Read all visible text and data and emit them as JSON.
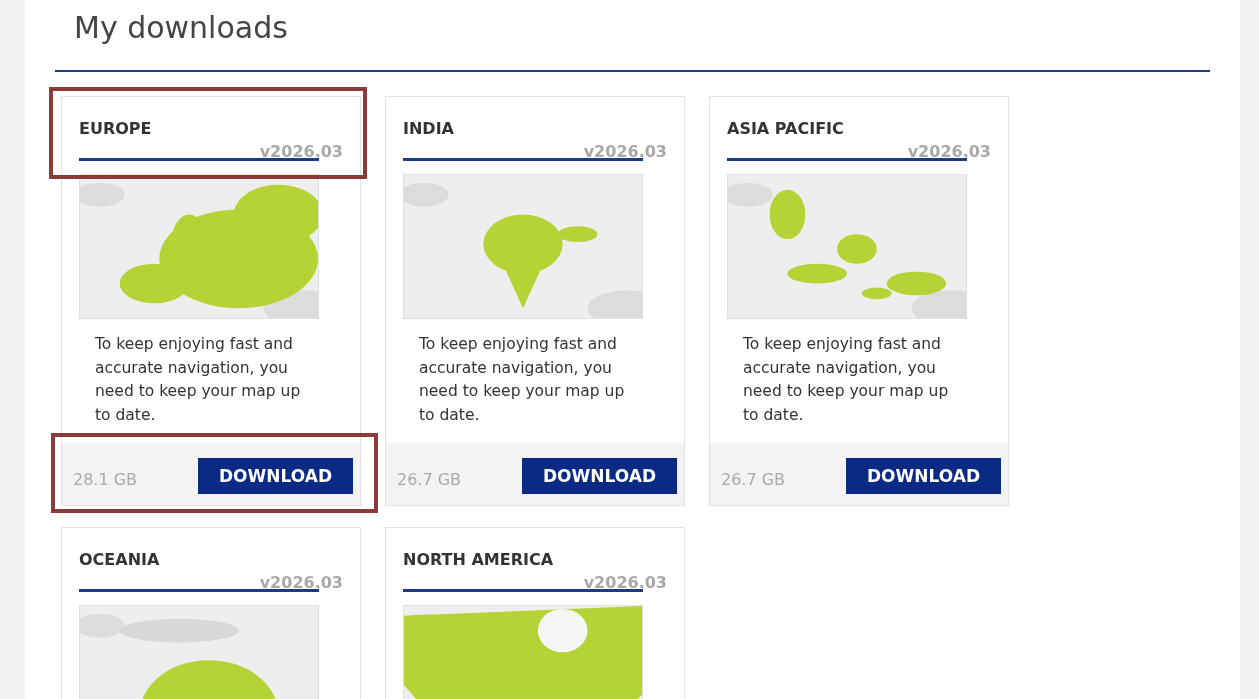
{
  "page_title": "My downloads",
  "cards": [
    {
      "region": "EUROPE",
      "version": "v2026.03",
      "description": "To keep enjoying fast and accurate navigation, you need to keep your map up to date.",
      "size": "28.1 GB",
      "button": "DOWNLOAD",
      "header_highlighted": true,
      "footer_highlighted": true
    },
    {
      "region": "INDIA",
      "version": "v2026.03",
      "description": "To keep enjoying fast and accurate navigation, you need to keep your map up to date.",
      "size": "26.7 GB",
      "button": "DOWNLOAD",
      "header_highlighted": false,
      "footer_highlighted": false
    },
    {
      "region": "ASIA PACIFIC",
      "version": "v2026.03",
      "description": "To keep enjoying fast and accurate navigation, you need to keep your map up to date.",
      "size": "26.7 GB",
      "button": "DOWNLOAD",
      "header_highlighted": false,
      "footer_highlighted": false
    },
    {
      "region": "OCEANIA",
      "version": "v2026.03",
      "header_highlighted": false,
      "footer_highlighted": false
    },
    {
      "region": "NORTH AMERICA",
      "version": "v2026.03",
      "header_highlighted": false,
      "footer_highlighted": false
    }
  ]
}
